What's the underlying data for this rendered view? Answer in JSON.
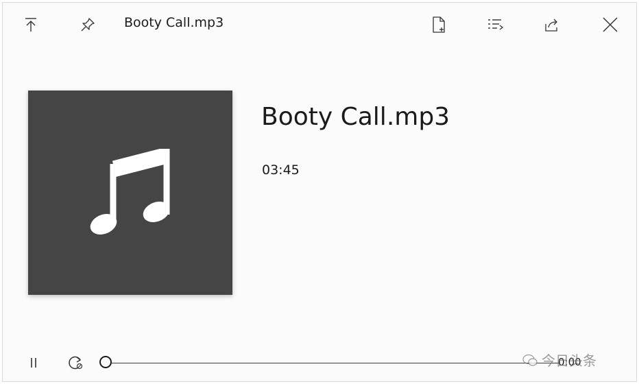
{
  "window": {
    "title": "Booty Call.mp3"
  },
  "toolbar": {
    "icons": [
      "keep-on-top-icon",
      "pin-icon",
      "file-info-icon",
      "playlist-icon",
      "share-icon",
      "close-icon"
    ]
  },
  "track": {
    "title": "Booty Call.mp3",
    "duration": "03:45"
  },
  "playback": {
    "elapsed": "0:00",
    "progress": 0
  },
  "watermark": {
    "text": "今日头条"
  },
  "colors": {
    "album_bg": "#454545",
    "window_bg": "#fbfbfb",
    "text": "#1a1a1a"
  }
}
